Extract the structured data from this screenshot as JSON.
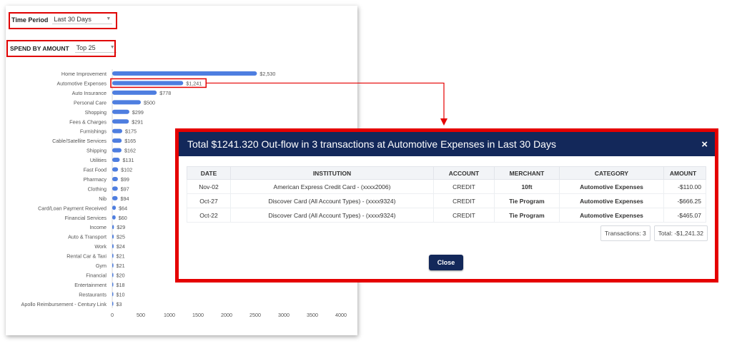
{
  "filters": {
    "time_period": {
      "label": "Time Period",
      "value": "Last 30 Days"
    },
    "spend_by": {
      "label": "SPEND BY AMOUNT",
      "value": "Top 25"
    }
  },
  "chart_data": {
    "type": "bar",
    "orientation": "horizontal",
    "color": "#4e7ee0",
    "categories": [
      "Home Improvement",
      "Automotive Expenses",
      "Auto Insurance",
      "Personal Care",
      "Shopping",
      "Fees & Charges",
      "Furnishings",
      "Cable/Satellite Services",
      "Shipping",
      "Utilities",
      "Fast Food",
      "Pharmacy",
      "Clothing",
      "Nib",
      "Card/Loan Payment Received",
      "Financial Services",
      "Income",
      "Auto & Transport",
      "Work",
      "Rental Car & Taxi",
      "Gym",
      "Financial",
      "Entertainment",
      "Restaurants",
      "Apollo Reimbursement - Century Link"
    ],
    "values": [
      2530,
      1241,
      778,
      500,
      299,
      291,
      175,
      165,
      162,
      131,
      102,
      99,
      97,
      94,
      64,
      60,
      29,
      25,
      24,
      21,
      21,
      20,
      18,
      10,
      3
    ],
    "value_labels": [
      "$2,530",
      "$1,241",
      "$778",
      "$500",
      "$299",
      "$291",
      "$175",
      "$165",
      "$162",
      "$131",
      "$102",
      "$99",
      "$97",
      "$94",
      "$64",
      "$60",
      "$29",
      "$25",
      "$24",
      "$21",
      "$21",
      "$20",
      "$18",
      "$10",
      "$3"
    ],
    "xlim": [
      0,
      4000
    ],
    "xticks": [
      "0",
      "500",
      "1000",
      "1500",
      "2000",
      "2500",
      "3000",
      "3500",
      "4000"
    ],
    "highlighted_category": "Automotive Expenses"
  },
  "modal": {
    "title": "Total $1241.320 Out-flow in 3 transactions at Automotive Expenses in Last 30 Days",
    "close_x": "×",
    "columns": [
      "DATE",
      "INSTITUTION",
      "ACCOUNT",
      "MERCHANT",
      "CATEGORY",
      "AMOUNT"
    ],
    "rows": [
      {
        "date": "Nov-02",
        "institution": "American Express Credit Card - (xxxx2006)",
        "account": "CREDIT",
        "merchant": "10ft",
        "category": "Automotive Expenses",
        "amount": "-$110.00"
      },
      {
        "date": "Oct-27",
        "institution": "Discover Card (All Account Types) - (xxxx9324)",
        "account": "CREDIT",
        "merchant": "Tie Program",
        "category": "Automotive Expenses",
        "amount": "-$666.25"
      },
      {
        "date": "Oct-22",
        "institution": "Discover Card (All Account Types) - (xxxx9324)",
        "account": "CREDIT",
        "merchant": "Tie Program",
        "category": "Automotive Expenses",
        "amount": "-$465.07"
      }
    ],
    "transactions_label": "Transactions: 3",
    "total_label": "Total: -$1,241.32",
    "close_button": "Close"
  },
  "colors": {
    "accent_red": "#e50000",
    "modal_header": "#13285a",
    "bar": "#4e7ee0"
  }
}
